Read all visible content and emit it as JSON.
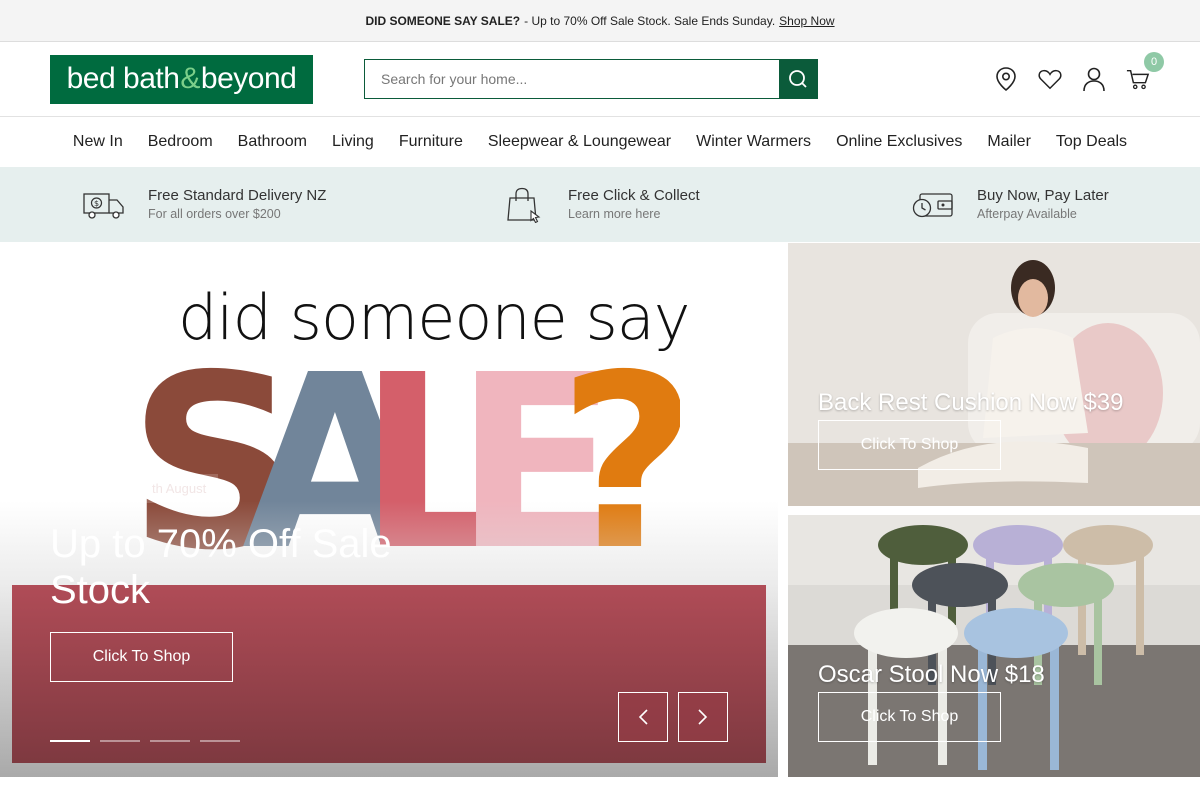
{
  "promo": {
    "bold": "DID SOMEONE SAY SALE?",
    "text": "- Up to 70% Off Sale Stock. Sale Ends Sunday.",
    "link": "Shop Now"
  },
  "header": {
    "logo": {
      "part1": "bed bath ",
      "amp": "&",
      "part2": "beyond"
    },
    "search_placeholder": "Search for your home...",
    "cart_count": "0",
    "icons": [
      "location-pin-icon",
      "heart-icon",
      "user-icon",
      "cart-icon"
    ]
  },
  "nav": {
    "items": [
      "New In",
      "Bedroom",
      "Bathroom",
      "Living",
      "Furniture",
      "Sleepwear & Loungewear",
      "Winter Warmers",
      "Online Exclusives",
      "Mailer",
      "Top Deals"
    ]
  },
  "usp": [
    {
      "title": "Free Standard Delivery NZ",
      "sub": "For all orders over $200",
      "icon": "delivery-truck-icon"
    },
    {
      "title": "Free Click & Collect",
      "sub": "Learn more here",
      "icon": "shopping-bag-icon"
    },
    {
      "title": "Buy Now, Pay Later",
      "sub": "Afterpay Available",
      "icon": "wallet-clock-icon"
    }
  ],
  "hero": {
    "tagline": "did someone say",
    "sale_word": "SALE?",
    "date_tag": "th August",
    "headline": "Up to 70% Off Sale Stock",
    "cta": "Click To Shop",
    "slide_count": 4,
    "active_slide": 1
  },
  "tiles": [
    {
      "title": "Back Rest Cushion Now $39",
      "cta": "Click To Shop"
    },
    {
      "title": "Oscar Stool Now $18",
      "cta": "Click To Shop"
    }
  ],
  "colors": {
    "brand_green": "#006b3f",
    "search_green": "#0b5b3a",
    "usp_bg": "#e6efee",
    "badge": "#8fc9a6",
    "hero_red": "#b04c57"
  }
}
